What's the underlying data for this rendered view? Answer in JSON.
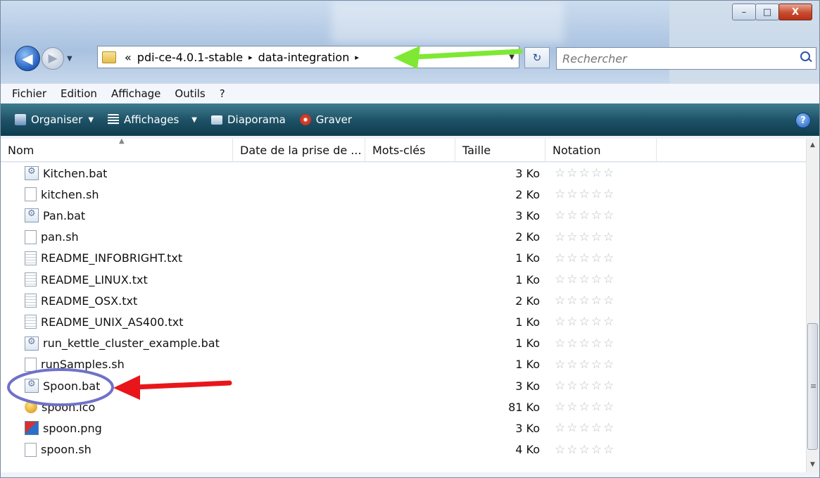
{
  "window": {
    "controls": {
      "minimize": "–",
      "maximize": "□",
      "close": "X"
    }
  },
  "nav": {
    "back_icon": "back-arrow-icon",
    "forward_icon": "forward-arrow-icon"
  },
  "address": {
    "prefix": "«",
    "crumbs": [
      "pdi-ce-4.0.1-stable",
      "data-integration"
    ],
    "separator": "▸"
  },
  "search": {
    "placeholder": "Rechercher"
  },
  "menu": [
    "Fichier",
    "Edition",
    "Affichage",
    "Outils",
    "?"
  ],
  "toolbar": [
    {
      "label": "Organiser",
      "icon": "organize-icon",
      "dropdown": true
    },
    {
      "label": "Affichages",
      "icon": "views-icon",
      "dropdown": true
    },
    {
      "label": "Diaporama",
      "icon": "slideshow-icon",
      "dropdown": false
    },
    {
      "label": "Graver",
      "icon": "burn-icon",
      "dropdown": false
    }
  ],
  "help": "?",
  "columns": [
    "Nom",
    "Date de la prise de ...",
    "Mots-clés",
    "Taille",
    "Notation"
  ],
  "rating_stars": "☆☆☆☆☆",
  "files": [
    {
      "name": "Kitchen.bat",
      "size": "3 Ko",
      "type": "bat"
    },
    {
      "name": "kitchen.sh",
      "size": "2 Ko",
      "type": "file"
    },
    {
      "name": "Pan.bat",
      "size": "3 Ko",
      "type": "bat"
    },
    {
      "name": "pan.sh",
      "size": "2 Ko",
      "type": "file"
    },
    {
      "name": "README_INFOBRIGHT.txt",
      "size": "1 Ko",
      "type": "txt"
    },
    {
      "name": "README_LINUX.txt",
      "size": "1 Ko",
      "type": "txt"
    },
    {
      "name": "README_OSX.txt",
      "size": "2 Ko",
      "type": "txt"
    },
    {
      "name": "README_UNIX_AS400.txt",
      "size": "1 Ko",
      "type": "txt"
    },
    {
      "name": "run_kettle_cluster_example.bat",
      "size": "1 Ko",
      "type": "bat"
    },
    {
      "name": "runSamples.sh",
      "size": "1 Ko",
      "type": "file"
    },
    {
      "name": "Spoon.bat",
      "size": "3 Ko",
      "type": "bat"
    },
    {
      "name": "spoon.ico",
      "size": "81 Ko",
      "type": "ico"
    },
    {
      "name": "spoon.png",
      "size": "3 Ko",
      "type": "png"
    },
    {
      "name": "spoon.sh",
      "size": "4 Ko",
      "type": "file"
    }
  ],
  "annotations": {
    "green_arrow_color": "#7ee832",
    "red_arrow_color": "#e8161a",
    "circle_color": "#6f72c8"
  }
}
